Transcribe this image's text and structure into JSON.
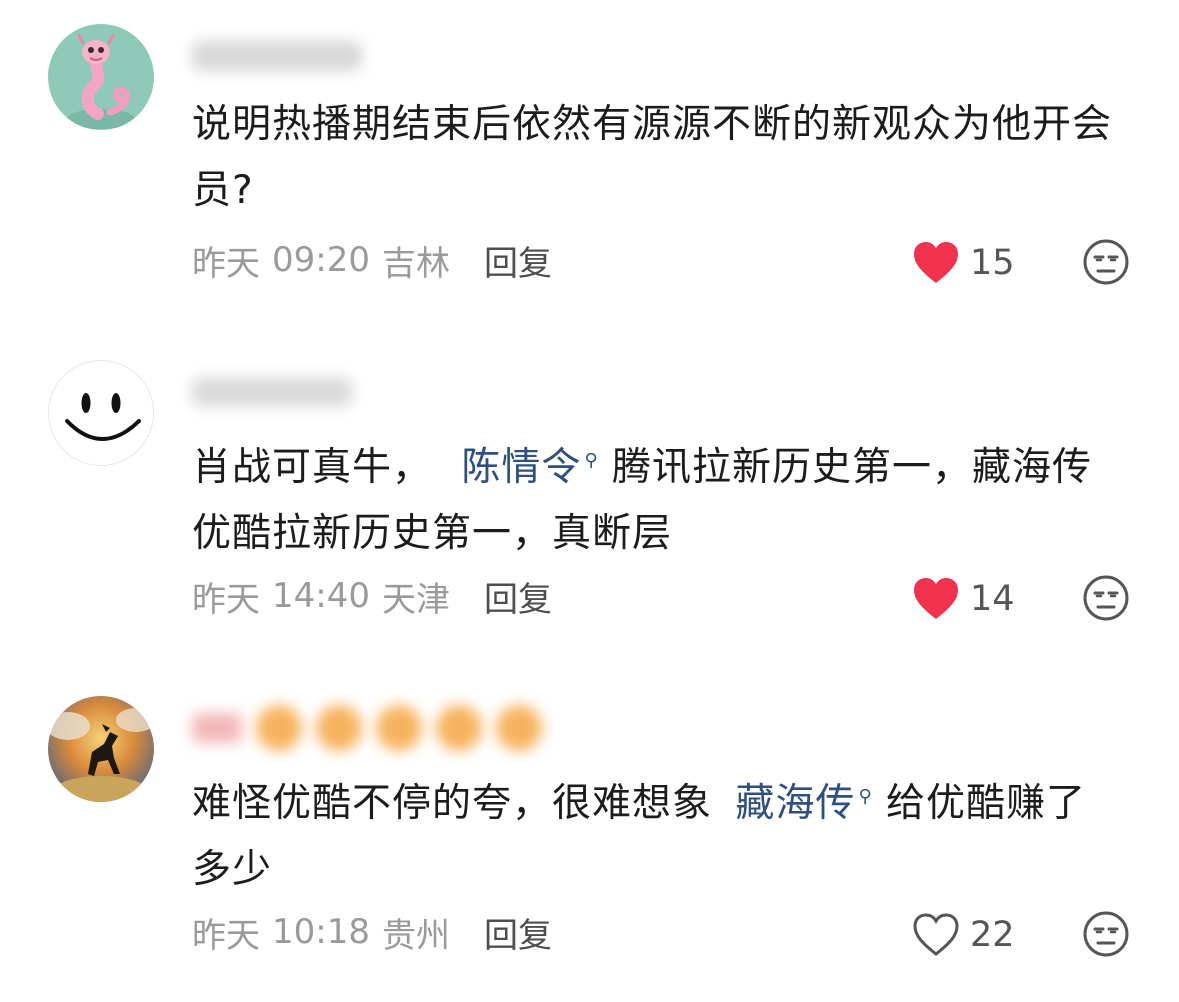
{
  "comments": [
    {
      "avatar_icon": "pink-dragon-avatar",
      "text": "说明热播期结束后依然有源源不断的新观众为他开会员?",
      "date": "昨天",
      "time": "09:20",
      "location": "吉林",
      "reply_label": "回复",
      "likes": "15",
      "liked": true
    },
    {
      "avatar_icon": "smiley-face-avatar",
      "text_before": "肖战可真牛，",
      "topic": "陈情令",
      "text_after": "腾讯拉新历史第一，藏海传优酷拉新历史第一，真断层",
      "date": "昨天",
      "time": "14:40",
      "location": "天津",
      "reply_label": "回复",
      "likes": "14",
      "liked": true
    },
    {
      "avatar_icon": "horse-painting-avatar",
      "text_before": "难怪优酷不停的夸，很难想象",
      "topic": "藏海传",
      "text_after": "给优酷赚了多少",
      "date": "昨天",
      "time": "10:18",
      "location": "贵州",
      "reply_label": "回复",
      "likes": "22",
      "liked": false
    }
  ],
  "colors": {
    "like_active": "#f0324e",
    "topic_link": "#2f4f80",
    "meta_text": "#9a9a9a"
  }
}
